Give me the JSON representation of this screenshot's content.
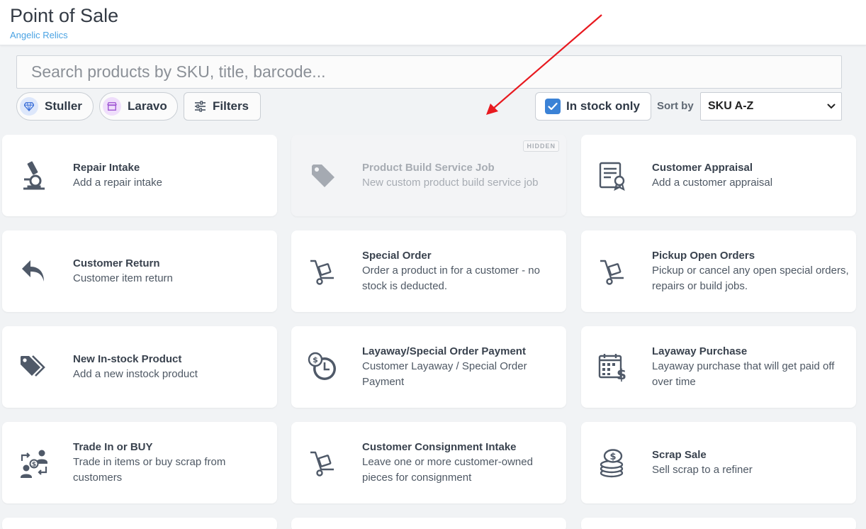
{
  "header": {
    "title": "Point of Sale",
    "subtitle": "Angelic Relics"
  },
  "search": {
    "placeholder": "Search products by SKU, title, barcode..."
  },
  "filters": {
    "vendors": [
      {
        "label": "Stuller",
        "icon": "diamond-icon",
        "color": "#3b6fd8"
      },
      {
        "label": "Laravo",
        "icon": "store-icon",
        "color": "#9b4fd1"
      }
    ],
    "filters_label": "Filters",
    "in_stock_label": "In stock only",
    "in_stock_checked": true,
    "sort_by_label": "Sort by",
    "sort_value": "SKU A-Z"
  },
  "cards": [
    {
      "title": "Repair Intake",
      "desc": "Add a repair intake",
      "icon": "microscope-icon",
      "hidden": false
    },
    {
      "title": "Product Build Service Job",
      "desc": "New custom product build service job",
      "icon": "tag-icon",
      "hidden": true,
      "badge": "HIDDEN"
    },
    {
      "title": "Customer Appraisal",
      "desc": "Add a customer appraisal",
      "icon": "certificate-icon",
      "hidden": false
    },
    {
      "title": "Customer Return",
      "desc": "Customer item return",
      "icon": "return-arrow-icon",
      "hidden": false
    },
    {
      "title": "Special Order",
      "desc": "Order a product in for a customer - no stock is deducted.",
      "icon": "hand-truck-icon",
      "hidden": false
    },
    {
      "title": "Pickup Open Orders",
      "desc": "Pickup or cancel any open special orders, repairs or build jobs.",
      "icon": "hand-truck-icon",
      "hidden": false
    },
    {
      "title": "New In-stock Product",
      "desc": "Add a new instock product",
      "icon": "tags-icon",
      "hidden": false
    },
    {
      "title": "Layaway/Special Order Payment",
      "desc": "Customer Layaway / Special Order Payment",
      "icon": "money-clock-icon",
      "hidden": false
    },
    {
      "title": "Layaway Purchase",
      "desc": "Layaway purchase that will get paid off over time",
      "icon": "calendar-dollar-icon",
      "hidden": false
    },
    {
      "title": "Trade In or BUY",
      "desc": "Trade in items or buy scrap from customers",
      "icon": "exchange-users-icon",
      "hidden": false
    },
    {
      "title": "Customer Consignment Intake",
      "desc": "Leave one or more customer-owned pieces for consignment",
      "icon": "hand-truck-icon",
      "hidden": false
    },
    {
      "title": "Scrap Sale",
      "desc": "Sell scrap to a refiner",
      "icon": "coins-stack-icon",
      "hidden": false
    }
  ],
  "colors": {
    "accent": "#3b82d6",
    "annotation_arrow": "#e8191f"
  }
}
